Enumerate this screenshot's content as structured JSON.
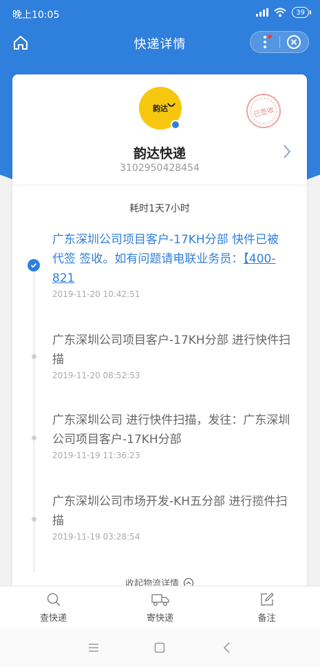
{
  "status_bar": {
    "time": "晚上10:05",
    "battery": "39"
  },
  "nav": {
    "title": "快递详情"
  },
  "carrier": {
    "logo_text": "韵达",
    "name": "韵达快递",
    "tracking_number": "3102950428454",
    "stamp_text": "已签收"
  },
  "duration_text": "耗时1天7小时",
  "events": [
    {
      "text": "广东深圳公司项目客户-17KH分部 快件已被 代签 签收。如有问题请电联业务员：",
      "phone": "【400-821",
      "time": "2019-11-20 10:42:51",
      "active": true
    },
    {
      "text": "广东深圳公司项目客户-17KH分部 进行快件扫描",
      "time": "2019-11-20 08:52:53",
      "active": false
    },
    {
      "text": "广东深圳公司 进行快件扫描，发往：广东深圳公司项目客户-17KH分部",
      "time": "2019-11-19 11:36:23",
      "active": false
    },
    {
      "text": "广东深圳公司市场开发-KH五分部 进行揽件扫描",
      "time": "2019-11-19 03:28:54",
      "active": false
    }
  ],
  "collapse_label": "收起物流详情",
  "tabs": [
    {
      "label": "查快递",
      "icon": "search-icon"
    },
    {
      "label": "寄快递",
      "icon": "truck-icon"
    },
    {
      "label": "备注",
      "icon": "edit-note-icon"
    }
  ],
  "colors": {
    "primary": "#2f7fdc",
    "logo_yellow": "#f7c60f"
  }
}
